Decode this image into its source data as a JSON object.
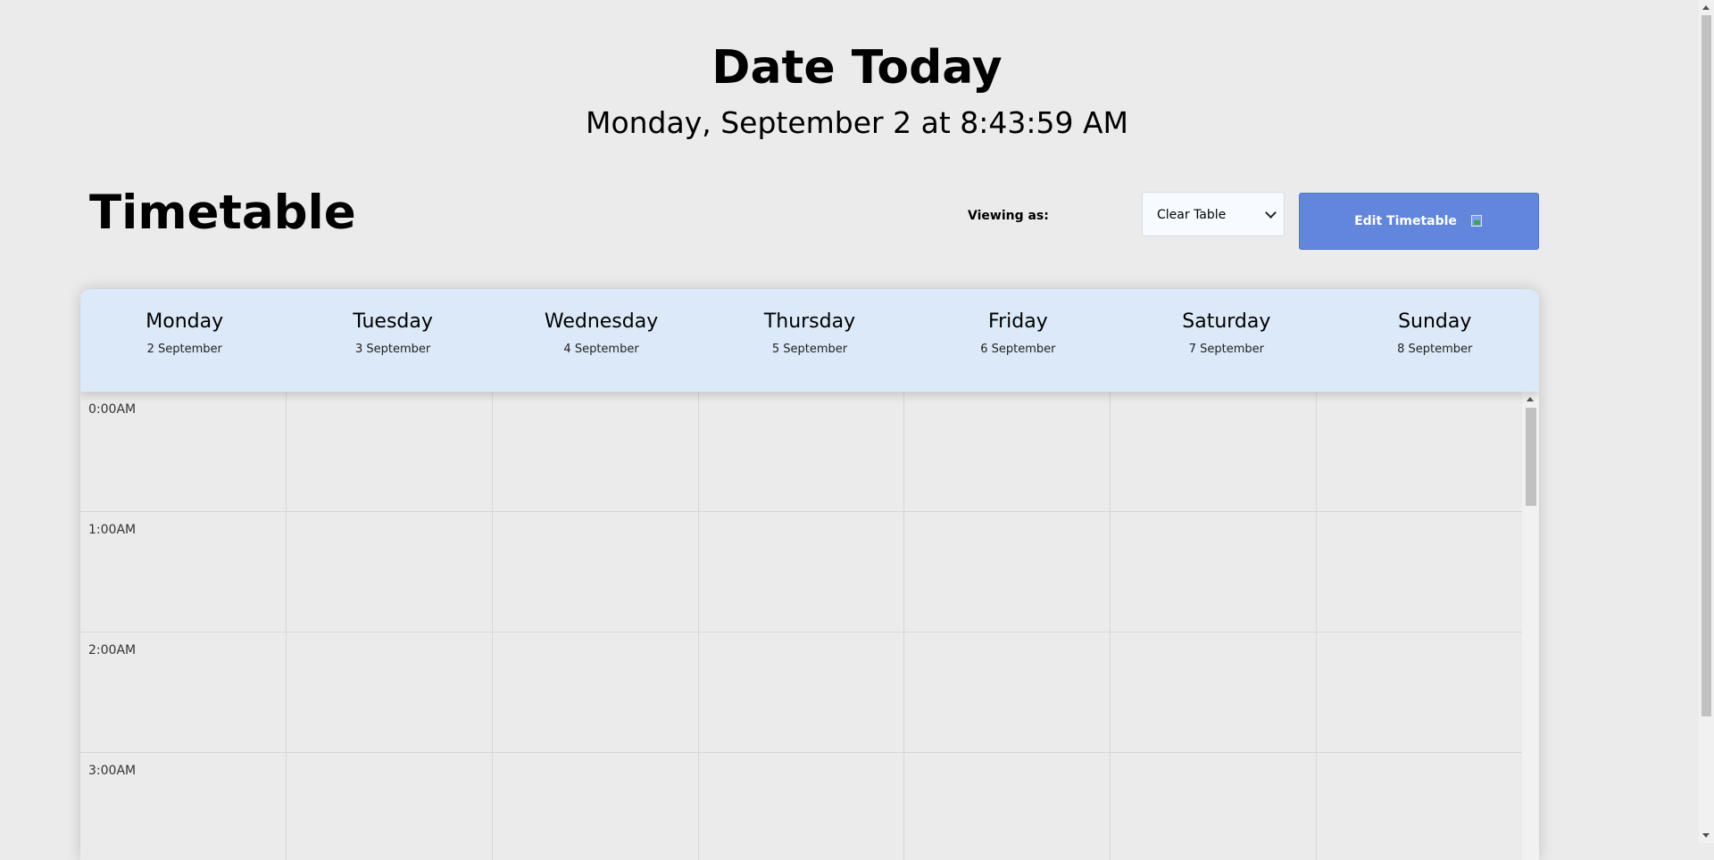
{
  "header": {
    "title": "Date Today",
    "datetime": "Monday, September 2 at 8:43:59 AM"
  },
  "timetable": {
    "title": "Timetable",
    "viewing_label": "Viewing as:",
    "select_value": "Clear Table",
    "edit_button_label": "Edit Timetable"
  },
  "days": [
    {
      "name": "Monday",
      "date": "2 September"
    },
    {
      "name": "Tuesday",
      "date": "3 September"
    },
    {
      "name": "Wednesday",
      "date": "4 September"
    },
    {
      "name": "Thursday",
      "date": "5 September"
    },
    {
      "name": "Friday",
      "date": "6 September"
    },
    {
      "name": "Saturday",
      "date": "7 September"
    },
    {
      "name": "Sunday",
      "date": "8 September"
    }
  ],
  "times": [
    "0:00AM",
    "1:00AM",
    "2:00AM",
    "3:00AM"
  ],
  "icons": {
    "select_arrow": "chevron-down-icon",
    "edit_button_icon": "broken-image-icon"
  },
  "colors": {
    "accent": "#6286dc",
    "day_header_bg": "#dbe9f8",
    "page_bg": "#ebebeb"
  }
}
